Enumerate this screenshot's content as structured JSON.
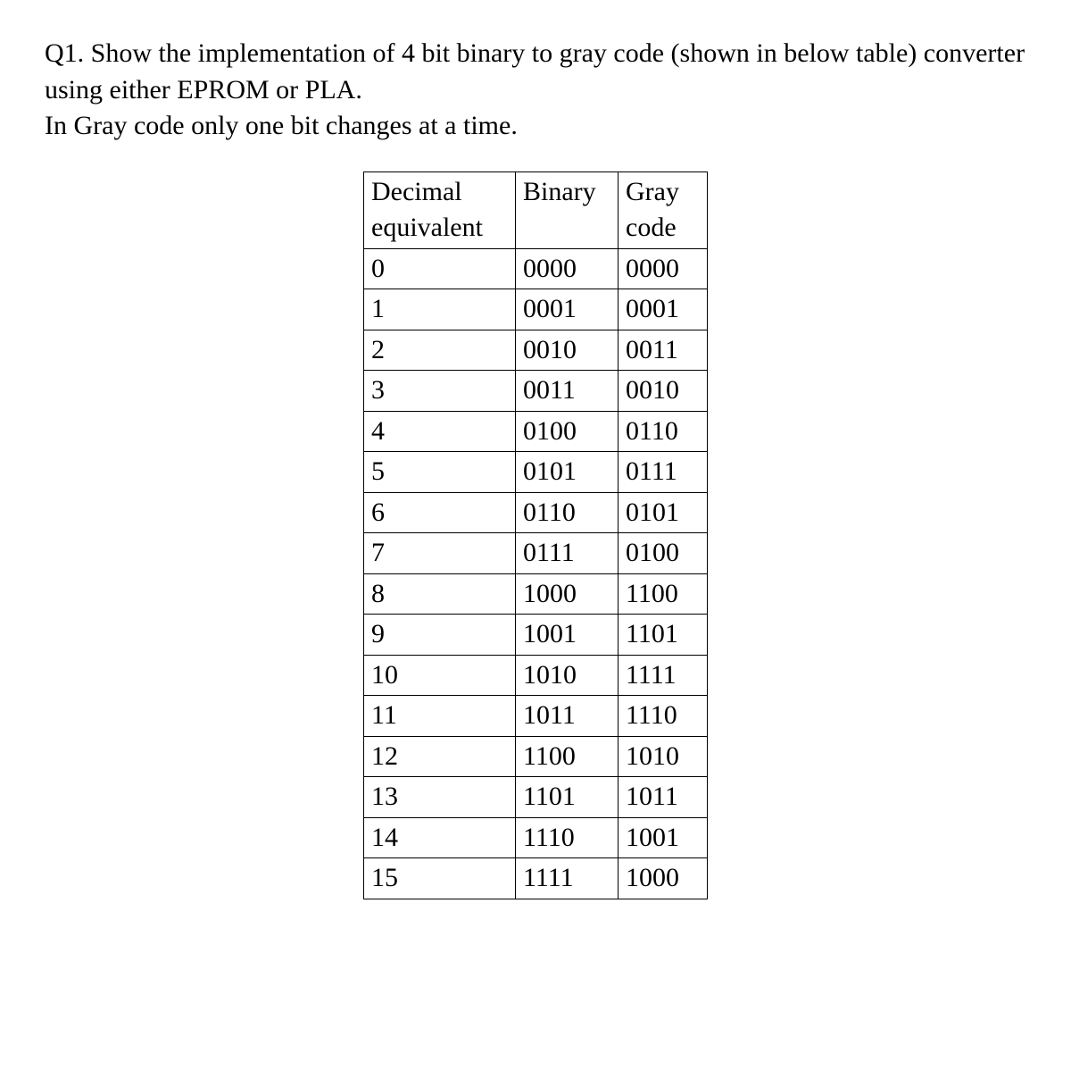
{
  "question": {
    "line1": "Q1. Show the implementation of 4 bit binary to gray code (shown in below table) converter using either EPROM or PLA.",
    "line2": "In Gray code only one bit changes at a time."
  },
  "table": {
    "headers": {
      "decimal": "Decimal equivalent",
      "binary": "Binary",
      "gray": "Gray code"
    },
    "rows": [
      {
        "decimal": "0",
        "binary": "0000",
        "gray": "0000"
      },
      {
        "decimal": "1",
        "binary": "0001",
        "gray": "0001"
      },
      {
        "decimal": "2",
        "binary": "0010",
        "gray": "0011"
      },
      {
        "decimal": "3",
        "binary": "0011",
        "gray": "0010"
      },
      {
        "decimal": "4",
        "binary": "0100",
        "gray": "0110"
      },
      {
        "decimal": "5",
        "binary": "0101",
        "gray": "0111"
      },
      {
        "decimal": "6",
        "binary": "0110",
        "gray": "0101"
      },
      {
        "decimal": "7",
        "binary": "0111",
        "gray": "0100"
      },
      {
        "decimal": "8",
        "binary": "1000",
        "gray": "1100"
      },
      {
        "decimal": "9",
        "binary": "1001",
        "gray": "1101"
      },
      {
        "decimal": "10",
        "binary": "1010",
        "gray": "1111"
      },
      {
        "decimal": "11",
        "binary": "1011",
        "gray": "1110"
      },
      {
        "decimal": "12",
        "binary": "1100",
        "gray": "1010"
      },
      {
        "decimal": "13",
        "binary": "1101",
        "gray": "1011"
      },
      {
        "decimal": "14",
        "binary": "1110",
        "gray": "1001"
      },
      {
        "decimal": "15",
        "binary": "1111",
        "gray": "1000"
      }
    ]
  }
}
